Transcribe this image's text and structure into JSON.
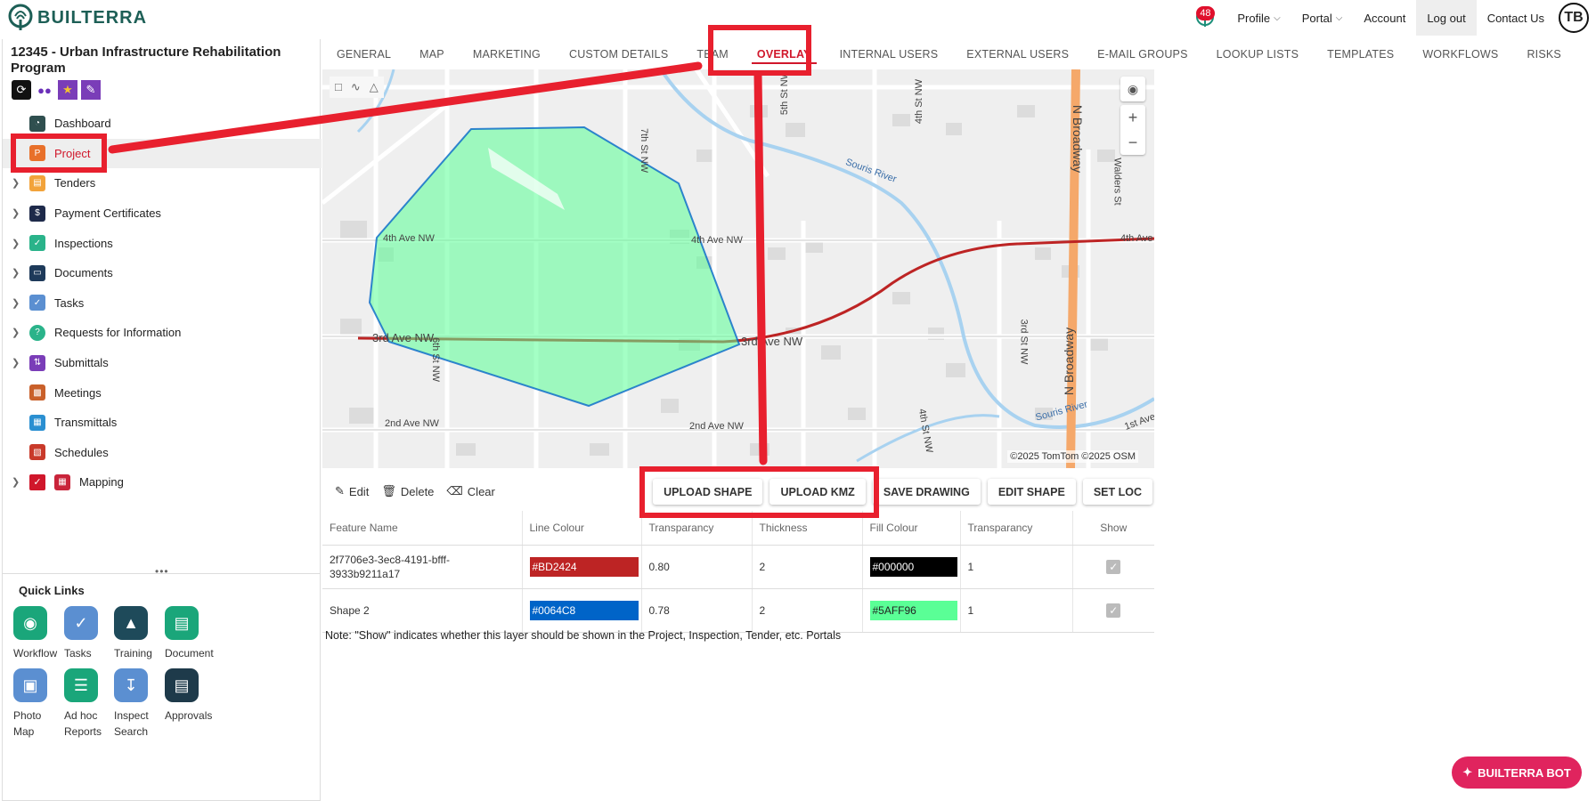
{
  "header": {
    "logo_text": "BUILTERRA",
    "notification_count": "48",
    "profile": "Profile",
    "portal": "Portal",
    "account": "Account",
    "logout": "Log out",
    "contact": "Contact Us",
    "avatar_initials": "TB"
  },
  "project": {
    "title": "12345 - Urban Infrastructure Rehabilitation Program"
  },
  "sidebar": {
    "items": [
      {
        "label": "Dashboard",
        "color": "#2f4f4f"
      },
      {
        "label": "Project",
        "color": "#e8702a"
      },
      {
        "label": "Tenders",
        "color": "#f2a33a"
      },
      {
        "label": "Payment Certificates",
        "color": "#1e2a4a"
      },
      {
        "label": "Inspections",
        "color": "#2ab38a"
      },
      {
        "label": "Documents",
        "color": "#1e3a5a"
      },
      {
        "label": "Tasks",
        "color": "#5b8fd1"
      },
      {
        "label": "Requests for Information",
        "color": "#2ab38a"
      },
      {
        "label": "Submittals",
        "color": "#7a3db8"
      },
      {
        "label": "Meetings",
        "color": "#c9602a"
      },
      {
        "label": "Transmittals",
        "color": "#2a8fd1"
      },
      {
        "label": "Schedules",
        "color": "#c93a2a"
      },
      {
        "label": "Mapping",
        "color": "#c9243a"
      }
    ]
  },
  "quick_links": {
    "title": "Quick Links",
    "items": [
      {
        "label": "Workflow",
        "color": "#1aa67a"
      },
      {
        "label": "Tasks",
        "color": "#5b8fd1"
      },
      {
        "label": "Training",
        "color": "#1e4a5a"
      },
      {
        "label": "Document",
        "color": "#1aa67a"
      },
      {
        "label": "Photo Map",
        "color": "#5b8fd1"
      },
      {
        "label": "Ad hoc Reports",
        "color": "#1aa67a"
      },
      {
        "label": "Inspect Search",
        "color": "#5b8fd1"
      },
      {
        "label": "Approvals",
        "color": "#1e3a4a"
      }
    ]
  },
  "tabs": [
    "General",
    "Map",
    "Marketing",
    "Custom Details",
    "Team",
    "Overlay",
    "Internal Users",
    "External Users",
    "E-mail Groups",
    "Lookup Lists",
    "Templates",
    "Workflows",
    "Risks"
  ],
  "active_tab": "Overlay",
  "map": {
    "labels": {
      "ave4_left": "4th Ave NW",
      "ave4_mid": "4th Ave NW",
      "ave4_right": "4th Ave",
      "ave3_left": "3rd Ave NW",
      "ave3_mid": "3rd Ave NW",
      "ave2_left": "2nd Ave NW",
      "ave2_mid": "2nd Ave NW",
      "ave1_right": "1st Ave",
      "st7": "7th St NW",
      "st6": "6th St NW",
      "st5": "5th St NW",
      "st4_top": "4th St NW",
      "st4_bottom": "4th St NW",
      "st3": "3rd St NW",
      "broadway_top": "N Broadway",
      "broadway_bottom": "N Broadway",
      "walders": "Walders St",
      "river_top": "Souris River",
      "river_bottom": "Souris River"
    },
    "attribution": "©2025 TomTom  ©2025 OSM"
  },
  "toolbar": {
    "edit": "Edit",
    "delete": "Delete",
    "clear": "Clear",
    "upload_shape": "UPLOAD SHAPE",
    "upload_kmz": "UPLOAD KMZ",
    "save_drawing": "SAVE DRAWING",
    "edit_shape": "EDIT SHAPE",
    "set_loc": "SET LOC"
  },
  "table": {
    "headers": [
      "Feature Name",
      "Line Colour",
      "Transparancy",
      "Thickness",
      "Fill Colour",
      "Transparancy",
      "Show"
    ],
    "rows": [
      {
        "name": "2f7706e3-3ec8-4191-bfff-3933b9211a17",
        "line_colour": "#BD2424",
        "line_transparency": "0.80",
        "thickness": "2",
        "fill_colour": "#000000",
        "fill_transparency": "1"
      },
      {
        "name": "Shape 2",
        "line_colour": "#0064C8",
        "line_transparency": "0.78",
        "thickness": "2",
        "fill_colour": "#5AFF96",
        "fill_transparency": "1"
      }
    ]
  },
  "note": "Note: \"Show\" indicates whether this layer should be shown in the Project, Inspection, Tender, etc. Portals",
  "bot_label": "BUILTERRA BOT",
  "colors": {
    "accent": "#d0172b",
    "annotation": "#e8202e",
    "polygon_fill": "#5aff96",
    "polygon_stroke": "#0064c8",
    "road_red": "#bd2424",
    "broadway": "#f5a86a",
    "river": "#a8d2f0"
  }
}
